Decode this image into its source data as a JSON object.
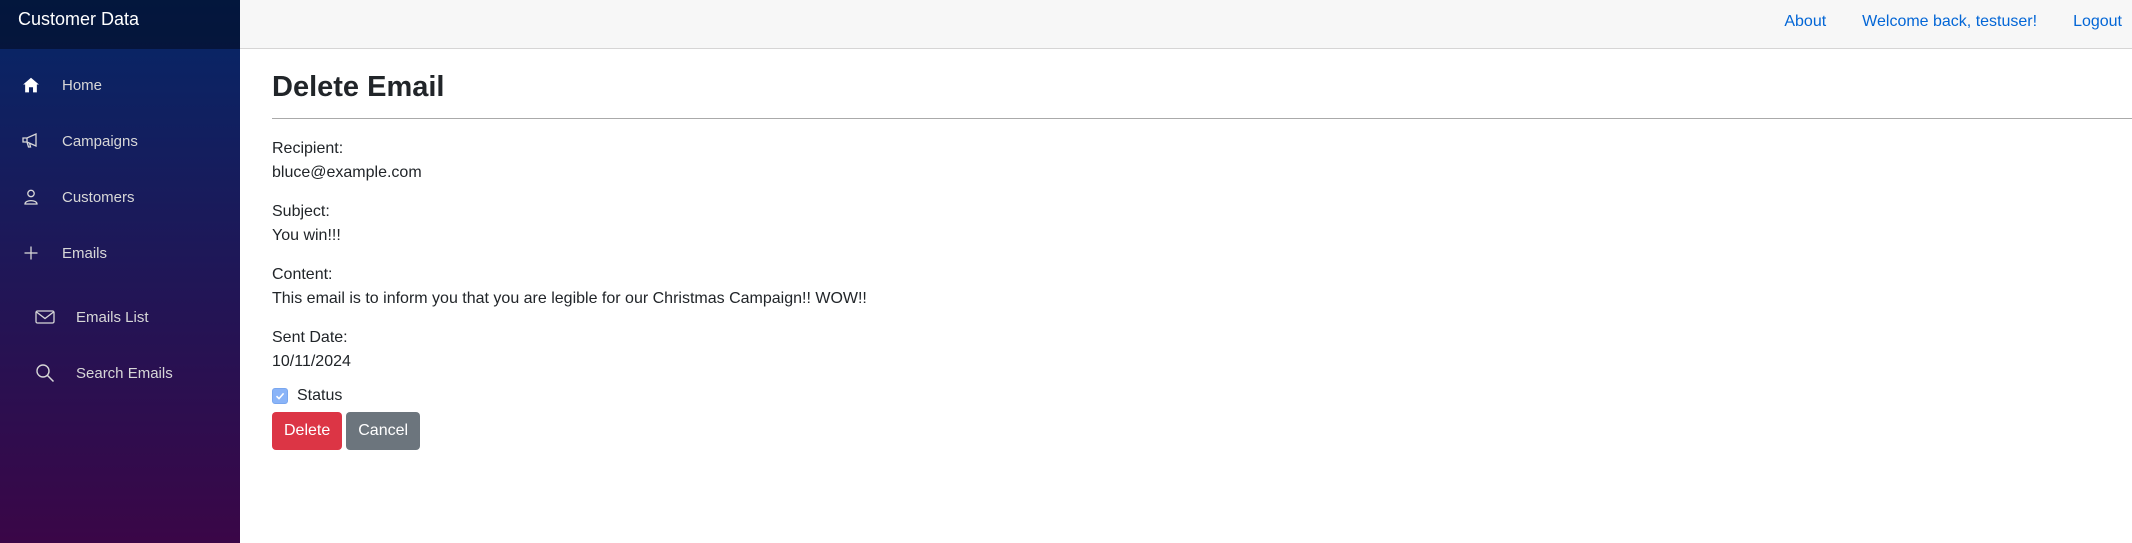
{
  "app": {
    "brand": "Customer Data"
  },
  "sidebar": {
    "items": [
      {
        "label": "Home",
        "icon": "home-icon"
      },
      {
        "label": "Campaigns",
        "icon": "megaphone-icon"
      },
      {
        "label": "Customers",
        "icon": "person-icon"
      },
      {
        "label": "Emails",
        "icon": "plus-icon"
      },
      {
        "label": "Emails List",
        "icon": "envelope-icon"
      },
      {
        "label": "Search Emails",
        "icon": "search-icon"
      }
    ]
  },
  "topbar": {
    "about": "About",
    "welcome": "Welcome back, testuser!",
    "logout": "Logout"
  },
  "page": {
    "title": "Delete Email",
    "fields": {
      "recipient_label": "Recipient:",
      "recipient_value": "bluce@example.com",
      "subject_label": "Subject:",
      "subject_value": "You win!!!",
      "content_label": "Content:",
      "content_value": "This email is to inform you that you are legible for our Christmas Campaign!! WOW!!",
      "sent_date_label": "Sent Date:",
      "sent_date_value": "10/11/2024"
    },
    "status": {
      "label": "Status",
      "checked": true
    },
    "buttons": {
      "delete": "Delete",
      "cancel": "Cancel"
    }
  },
  "colors": {
    "link": "#0366d6",
    "danger": "#dc3545",
    "secondary": "#6c757d",
    "sidebar_top": "#052767",
    "sidebar_bottom": "#3a0647"
  }
}
